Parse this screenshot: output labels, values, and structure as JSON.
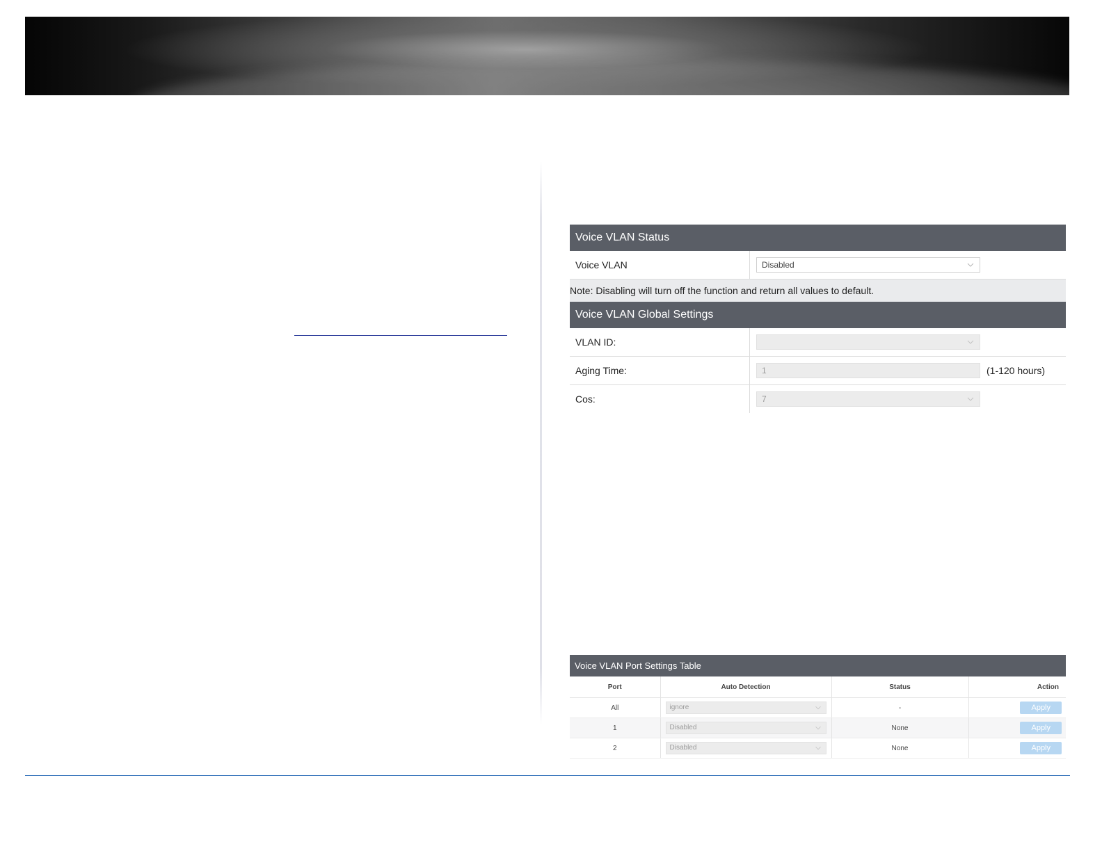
{
  "voice_vlan_status": {
    "header": "Voice VLAN Status",
    "voice_vlan_label": "Voice VLAN",
    "voice_vlan_value": "Disabled",
    "note": "Note: Disabling will turn off the function and return all values to default."
  },
  "global_settings": {
    "header": "Voice VLAN Global Settings",
    "vlan_id_label": "VLAN ID:",
    "vlan_id_value": "",
    "aging_time_label": "Aging Time:",
    "aging_time_value": "1",
    "aging_time_unit": "(1-120 hours)",
    "cos_label": "Cos:",
    "cos_value": "7"
  },
  "port_table": {
    "header": "Voice VLAN Port Settings Table",
    "columns": [
      "Port",
      "Auto Detection",
      "Status",
      "Action"
    ],
    "rows": [
      {
        "port": "All",
        "auto_detection": "ignore",
        "status": "-",
        "action": "Apply"
      },
      {
        "port": "1",
        "auto_detection": "Disabled",
        "status": "None",
        "action": "Apply"
      },
      {
        "port": "2",
        "auto_detection": "Disabled",
        "status": "None",
        "action": "Apply"
      }
    ]
  },
  "colors": {
    "section_header": "#5a5e66",
    "note_background": "#eaebed",
    "apply_button": "#b7d7f2",
    "footer_rule": "#2f6fb8"
  }
}
